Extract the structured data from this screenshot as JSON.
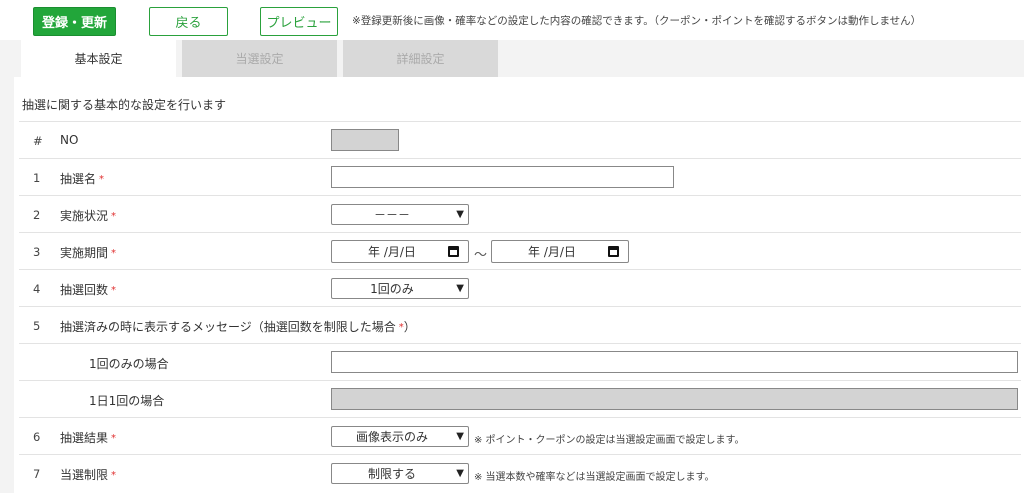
{
  "toolbar": {
    "save_label": "登録・更新",
    "back_label": "戻る",
    "preview_label": "プレビュー",
    "note": "※登録更新後に画像・確率などの設定した内容の確認できます。（クーポン・ポイントを確認するボタンは動作しません）"
  },
  "tabs": [
    {
      "label": "基本設定"
    },
    {
      "label": "当選設定"
    },
    {
      "label": "詳細設定"
    }
  ],
  "intro": "抽選に関する基本的な設定を行います",
  "rows": {
    "no": {
      "num": "#",
      "label": "NO"
    },
    "name": {
      "num": "1",
      "label": "抽選名",
      "req": "*"
    },
    "status": {
      "num": "2",
      "label": "実施状況",
      "req": "*",
      "value": "－－－"
    },
    "period": {
      "num": "3",
      "label": "実施期間",
      "req": "*",
      "start": "年 /月/日",
      "end": "年 /月/日",
      "separator": "～"
    },
    "count": {
      "num": "4",
      "label": "抽選回数",
      "req": "*",
      "value": "1回のみ"
    },
    "message": {
      "num": "5",
      "label": "抽選済みの時に表示するメッセージ（抽選回数を制限した場合",
      "req": "*",
      "close": "）"
    },
    "once": {
      "label": "1回のみの場合"
    },
    "daily": {
      "label": "1日1回の場合"
    },
    "result": {
      "num": "6",
      "label": "抽選結果",
      "req": "*",
      "value": "画像表示のみ",
      "note": "※ ポイント・クーポンの設定は当選設定画面で設定します。"
    },
    "limit": {
      "num": "7",
      "label": "当選制限",
      "req": "*",
      "value": "制限する",
      "note": "※ 当選本数や確率などは当選設定画面で設定します。"
    }
  },
  "colors": {
    "accent": "#22a63a",
    "required": "#e03030",
    "inactive_tab": "#d9d9d9"
  },
  "icons": {
    "select": "chevron-down-icon",
    "date": "calendar-icon"
  }
}
